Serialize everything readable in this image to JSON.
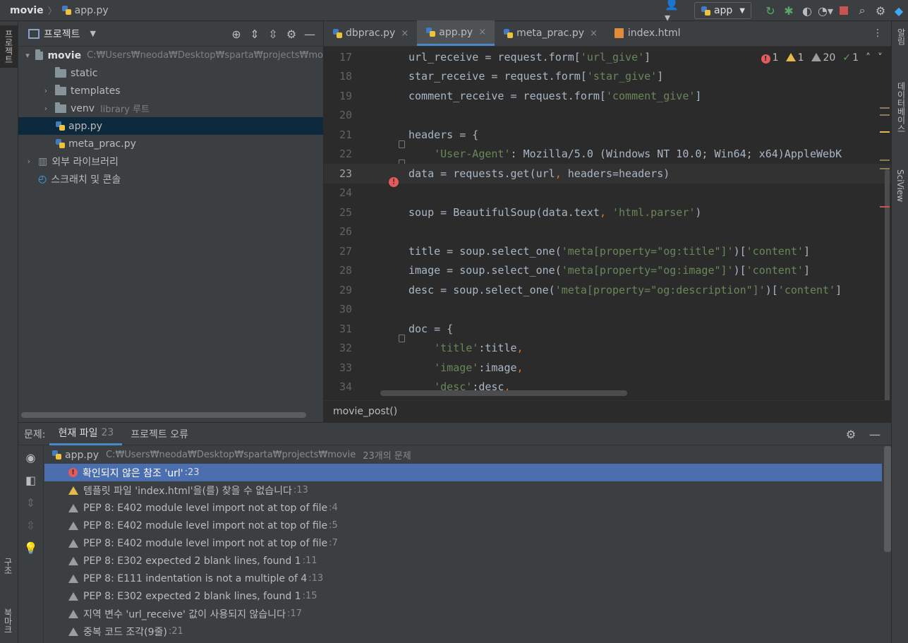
{
  "navbar": {
    "project": "movie",
    "file": "app.py",
    "run_config": "app"
  },
  "left_strip": {
    "project_label": "프로젝트",
    "structure_label": "구조",
    "bookmarks_label": "북마크"
  },
  "right_strip": {
    "notifications_label": "알림",
    "database_label": "데이터베이스",
    "sciview_label": "SciView"
  },
  "project_panel": {
    "title": "프로젝트",
    "tree": [
      {
        "label": "movie",
        "hint": "C:₩Users₩neoda₩Desktop₩sparta₩projects₩mo",
        "type": "folder",
        "depth": 0,
        "expanded": true
      },
      {
        "label": "static",
        "hint": "",
        "type": "folder",
        "depth": 1,
        "expanded": false
      },
      {
        "label": "templates",
        "hint": "",
        "type": "folder",
        "depth": 1,
        "expanded": false
      },
      {
        "label": "venv",
        "hint": "library 루트",
        "type": "folder",
        "depth": 1,
        "expanded": false
      },
      {
        "label": "app.py",
        "hint": "",
        "type": "py",
        "depth": 1,
        "selected": true
      },
      {
        "label": "meta_prac.py",
        "hint": "",
        "type": "py",
        "depth": 1
      },
      {
        "label": "외부 라이브러리",
        "hint": "",
        "type": "lib",
        "depth": 0
      },
      {
        "label": "스크래치 및 콘솔",
        "hint": "",
        "type": "scratch",
        "depth": 0
      }
    ]
  },
  "editor": {
    "tabs": [
      {
        "label": "dbprac.py",
        "type": "py",
        "active": false
      },
      {
        "label": "app.py",
        "type": "py",
        "active": true
      },
      {
        "label": "meta_prac.py",
        "type": "py",
        "active": false
      },
      {
        "label": "index.html",
        "type": "html",
        "active": false
      }
    ],
    "inspections": {
      "errors": "1",
      "warnings": "1",
      "weak_warnings": "20",
      "ok": "1"
    },
    "current_line": 23,
    "lines": [
      {
        "n": "17",
        "code": "url_receive = request.form['url_give']"
      },
      {
        "n": "18",
        "code": "star_receive = request.form['star_give']"
      },
      {
        "n": "19",
        "code": "comment_receive = request.form['comment_give']"
      },
      {
        "n": "20",
        "code": ""
      },
      {
        "n": "21",
        "code": "headers = {"
      },
      {
        "n": "22",
        "code": "    'User-Agent': 'Mozilla/5.0 (Windows NT 10.0; Win64; x64)AppleWebK"
      },
      {
        "n": "23",
        "code": "data = requests.get(url, headers=headers)"
      },
      {
        "n": "24",
        "code": ""
      },
      {
        "n": "25",
        "code": "soup = BeautifulSoup(data.text, 'html.parser')"
      },
      {
        "n": "26",
        "code": ""
      },
      {
        "n": "27",
        "code": "title = soup.select_one('meta[property=\"og:title\"]')['content']"
      },
      {
        "n": "28",
        "code": "image = soup.select_one('meta[property=\"og:image\"]')['content']"
      },
      {
        "n": "29",
        "code": "desc = soup.select_one('meta[property=\"og:description\"]')['content']"
      },
      {
        "n": "30",
        "code": ""
      },
      {
        "n": "31",
        "code": "doc = {"
      },
      {
        "n": "32",
        "code": "    'title':title,"
      },
      {
        "n": "33",
        "code": "    'image':image,"
      },
      {
        "n": "34",
        "code": "    'desc':desc,"
      }
    ],
    "breadcrumb": "movie_post()"
  },
  "problems": {
    "label": "문제:",
    "tabs": [
      {
        "label": "현재 파일",
        "count": "23",
        "active": true
      },
      {
        "label": "프로젝트 오류",
        "count": "",
        "active": false
      }
    ],
    "file": {
      "name": "app.py",
      "path": "C:₩Users₩neoda₩Desktop₩sparta₩projects₩movie",
      "summary": "23개의 문제"
    },
    "items": [
      {
        "severity": "error",
        "text": "확인되지 않은 참조 'url'",
        "loc": ":23",
        "selected": true
      },
      {
        "severity": "warning",
        "text": "템플릿 파일 'index.html'을(를) 찾을 수 없습니다",
        "loc": ":13"
      },
      {
        "severity": "weak",
        "text": "PEP 8: E402 module level import not at top of file",
        "loc": ":4"
      },
      {
        "severity": "weak",
        "text": "PEP 8: E402 module level import not at top of file",
        "loc": ":5"
      },
      {
        "severity": "weak",
        "text": "PEP 8: E402 module level import not at top of file",
        "loc": ":7"
      },
      {
        "severity": "weak",
        "text": "PEP 8: E302 expected 2 blank lines, found 1",
        "loc": ":11"
      },
      {
        "severity": "weak",
        "text": "PEP 8: E111 indentation is not a multiple of 4",
        "loc": ":13"
      },
      {
        "severity": "weak",
        "text": "PEP 8: E302 expected 2 blank lines, found 1",
        "loc": ":15"
      },
      {
        "severity": "weak",
        "text": "지역 변수 'url_receive' 값이 사용되지 않습니다",
        "loc": ":17"
      },
      {
        "severity": "weak",
        "text": "중복 코드 조각(9줄)",
        "loc": ":21"
      }
    ]
  },
  "colors": {
    "selection": "#4b6eaf",
    "tab_underline": "#4a88c7",
    "error": "#e55a5a",
    "warning": "#e8b84a",
    "string": "#6a8759",
    "keyword": "#cc7832"
  }
}
